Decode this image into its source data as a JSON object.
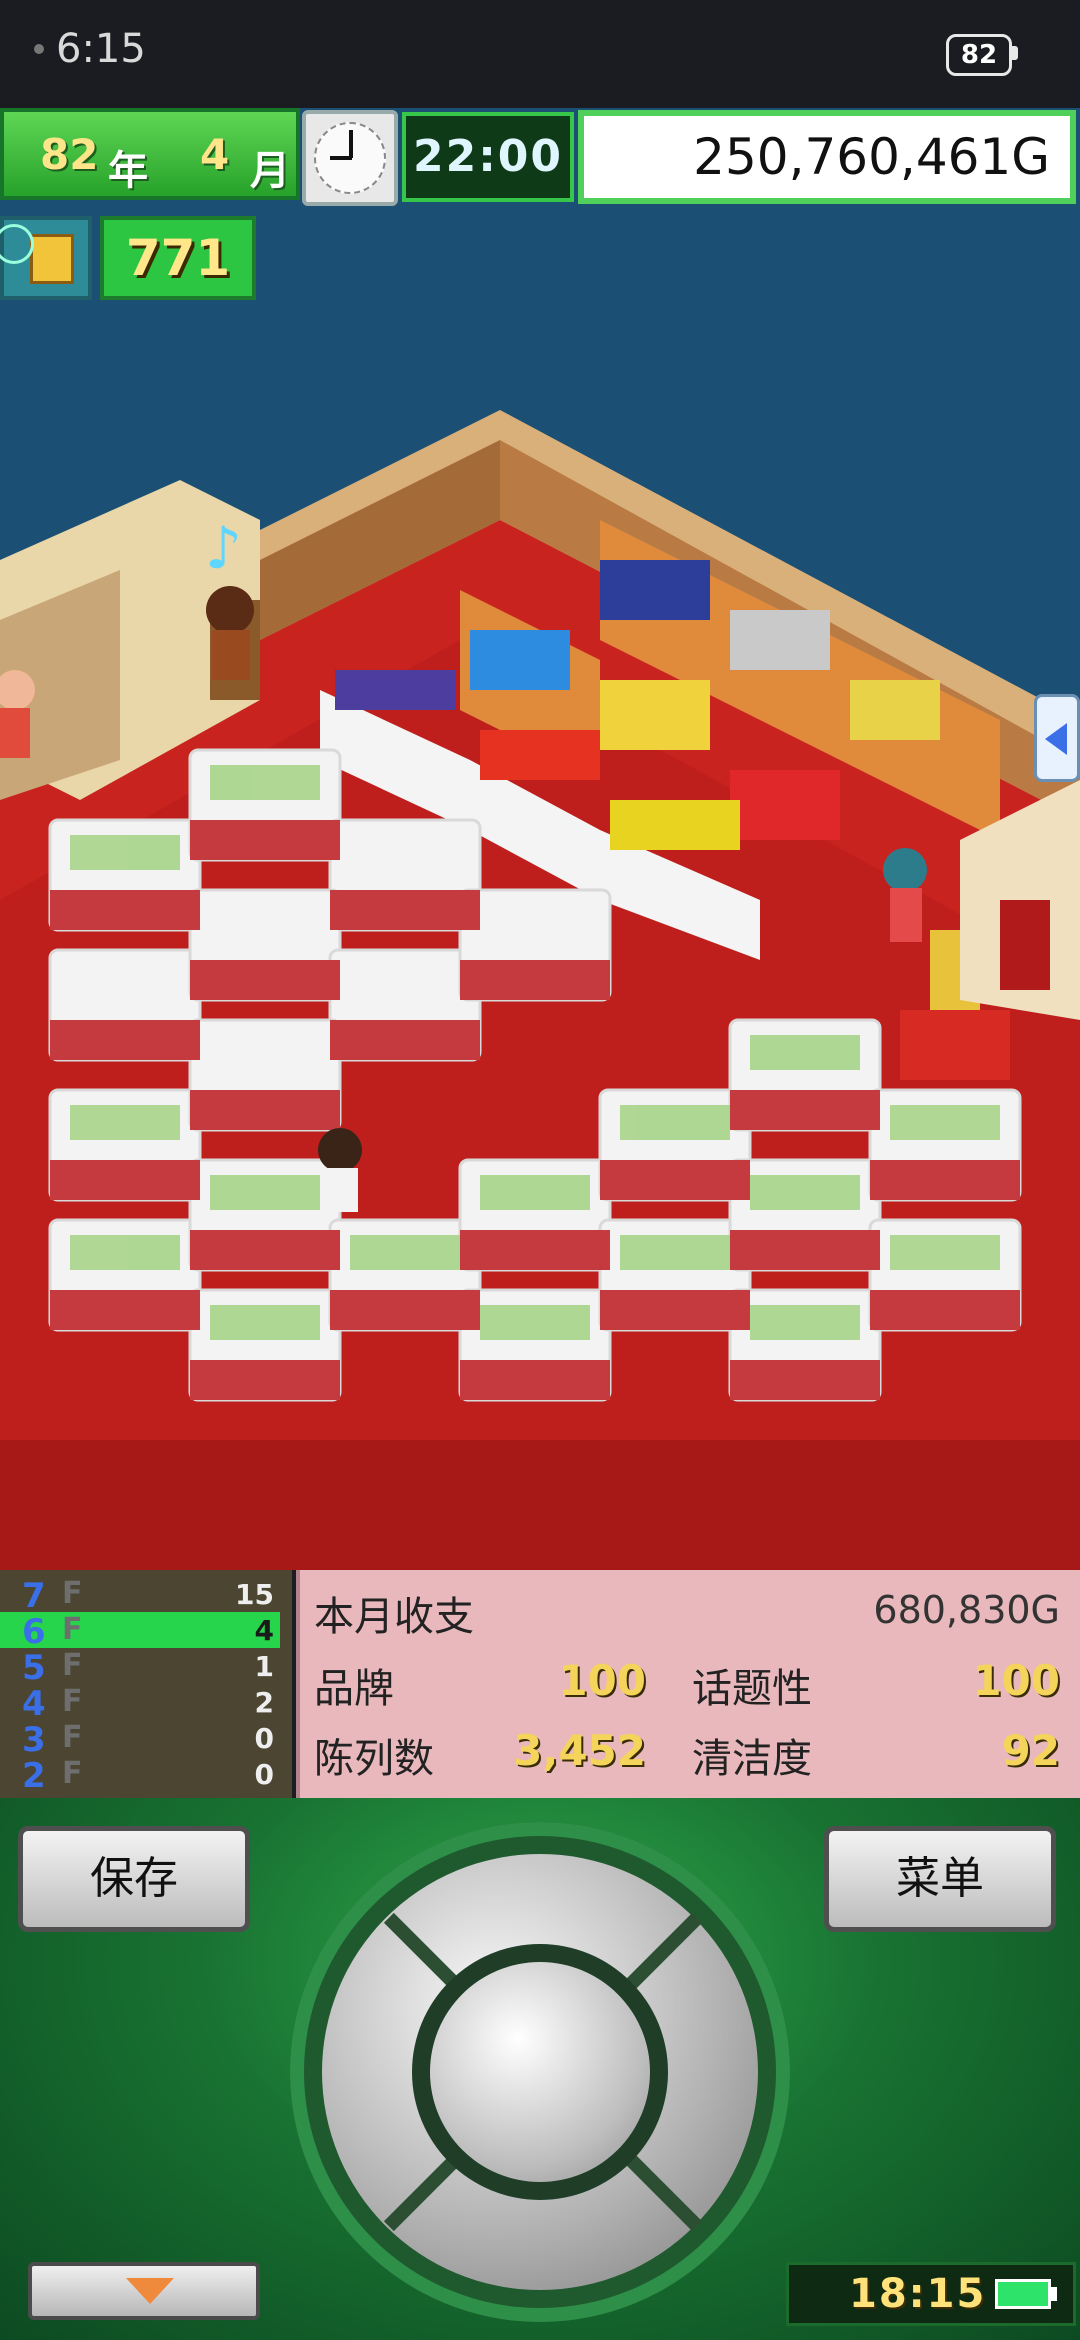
{
  "status_bar": {
    "time": "6:15",
    "battery": "82"
  },
  "hud": {
    "year": "82",
    "year_label": "年",
    "month": "4",
    "month_label": "月",
    "time": "22:00",
    "money": "250,760,461G",
    "points": "771"
  },
  "floors": [
    {
      "label": "7",
      "suffix": "F",
      "count": "15",
      "active": false
    },
    {
      "label": "6",
      "suffix": "F",
      "count": "4",
      "active": true
    },
    {
      "label": "5",
      "suffix": "F",
      "count": "1",
      "active": false
    },
    {
      "label": "4",
      "suffix": "F",
      "count": "2",
      "active": false
    },
    {
      "label": "3",
      "suffix": "F",
      "count": "0",
      "active": false
    },
    {
      "label": "2",
      "suffix": "F",
      "count": "0",
      "active": false
    }
  ],
  "stats": {
    "monthly_label": "本月收支",
    "monthly_value": "680,830G",
    "brand_label": "品牌",
    "brand_value": "100",
    "topic_label": "话题性",
    "topic_value": "100",
    "display_label": "陈列数",
    "display_value": "3,452",
    "clean_label": "清洁度",
    "clean_value": "92"
  },
  "controls": {
    "save_label": "保存",
    "menu_label": "菜单",
    "clock": "18:15"
  },
  "icons": {
    "clock": "analog-clock-icon",
    "badge": "document-icon",
    "dpad": "directional-pad-icon",
    "down": "down-arrow-icon",
    "battery": "battery-icon",
    "scroll": "left-arrow-icon"
  },
  "colors": {
    "hud_green": "#2cc643",
    "floor_active": "#27d54d",
    "stat_panel": "#e8b8bc",
    "floor_blue": "#3a6fe8"
  }
}
